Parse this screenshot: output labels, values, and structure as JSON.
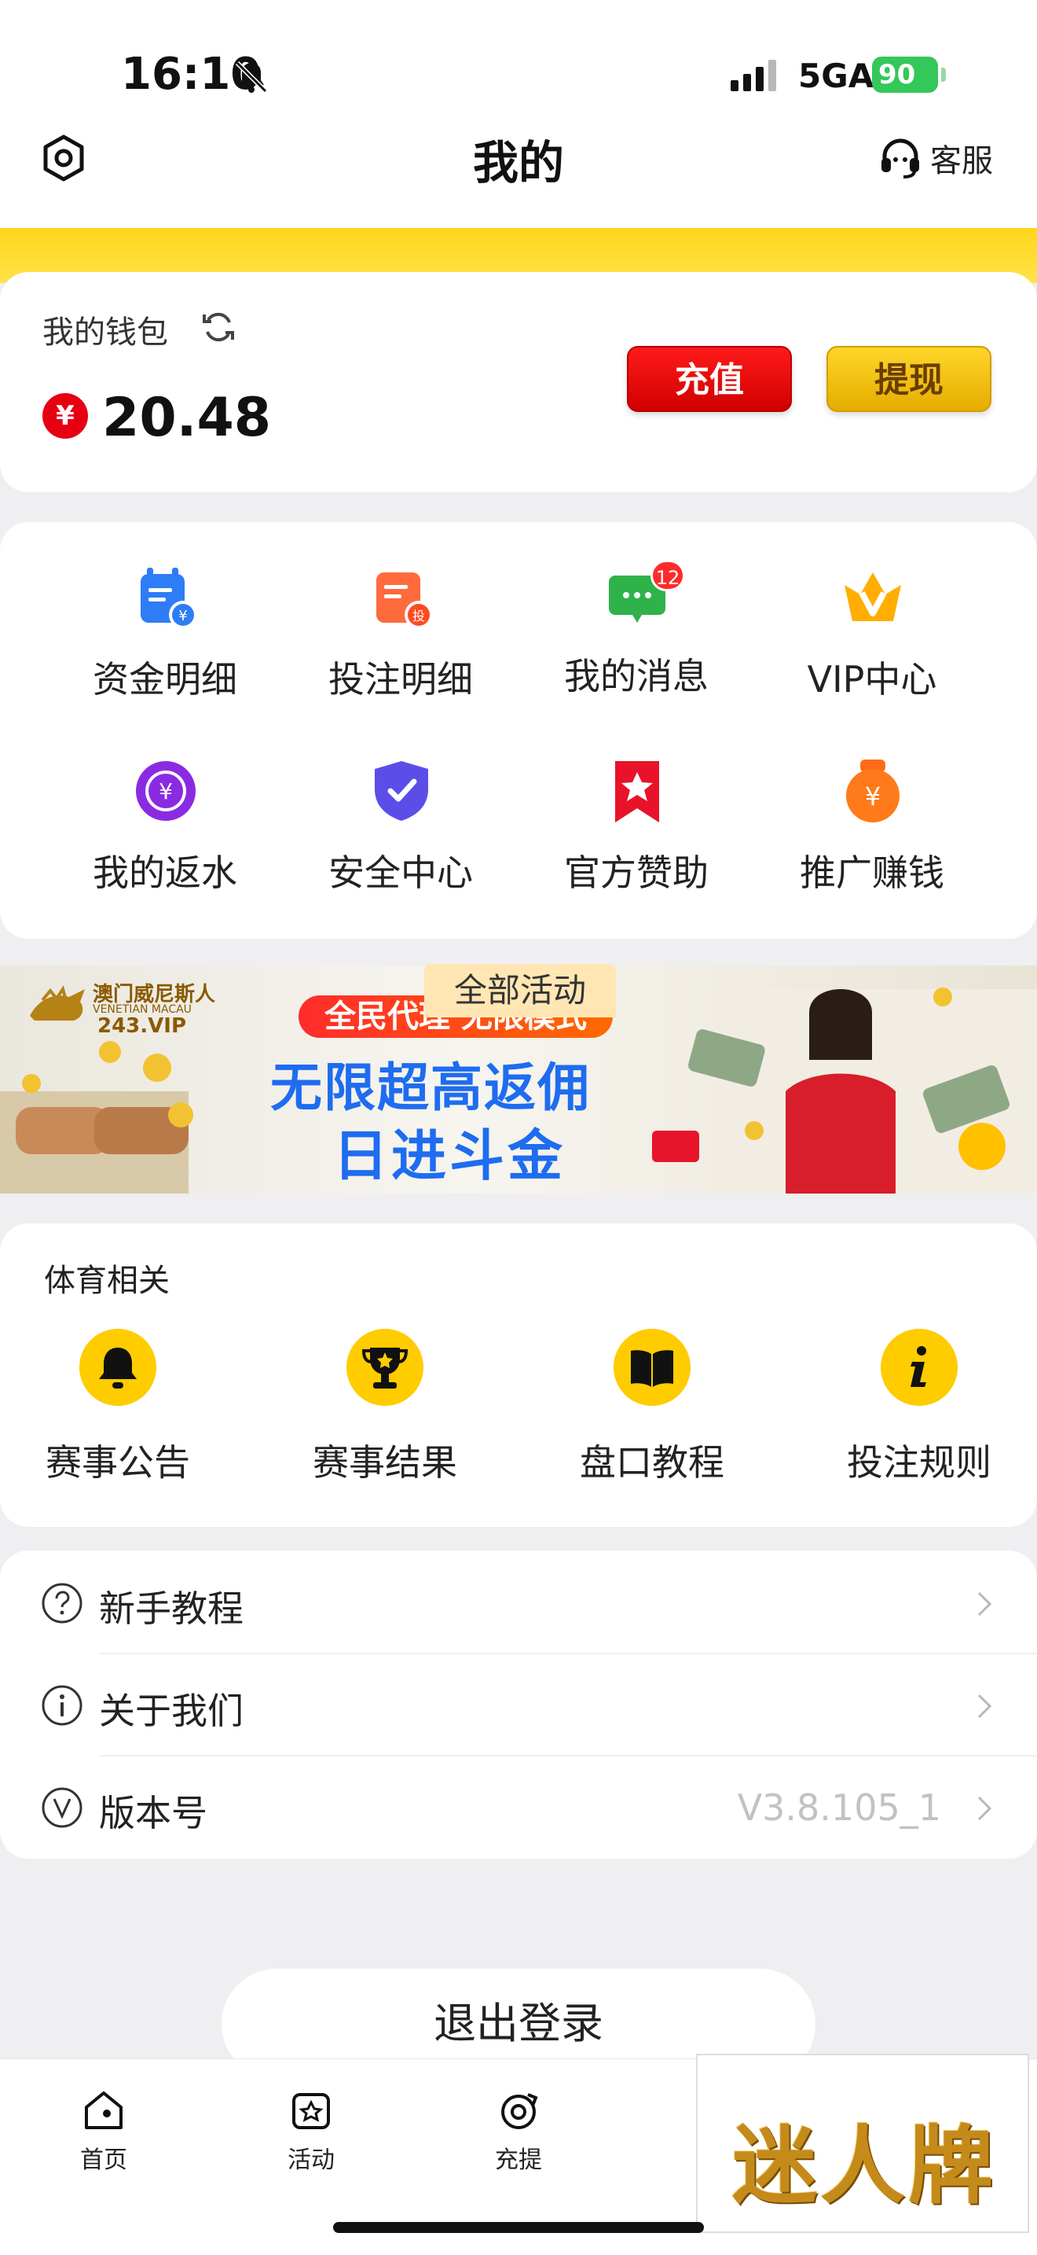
{
  "status_bar": {
    "time": "16:10",
    "network": "5GA",
    "battery": "90"
  },
  "header": {
    "title": "我的",
    "customer_service": "客服"
  },
  "wallet": {
    "title": "我的钱包",
    "currency_symbol": "¥",
    "balance": "20.48",
    "recharge_label": "充值",
    "withdraw_label": "提现"
  },
  "menu": {
    "items": [
      {
        "label": "资金明细",
        "icon": "fund-details-icon"
      },
      {
        "label": "投注明细",
        "icon": "bet-details-icon"
      },
      {
        "label": "我的消息",
        "icon": "message-icon",
        "badge": "12"
      },
      {
        "label": "VIP中心",
        "icon": "vip-icon"
      },
      {
        "label": "我的返水",
        "icon": "rebate-icon"
      },
      {
        "label": "安全中心",
        "icon": "shield-icon"
      },
      {
        "label": "官方赞助",
        "icon": "sponsor-icon"
      },
      {
        "label": "推广赚钱",
        "icon": "promote-icon"
      }
    ]
  },
  "banner": {
    "tab": "全部活动",
    "pill": "全民代理 无限模式",
    "line1": "无限超高返佣",
    "line2": "日进斗金",
    "logo_cn": "澳门威尼斯人",
    "logo_en": "VENETIAN MACAU",
    "logo_site": "243.VIP"
  },
  "sports": {
    "title": "体育相关",
    "items": [
      {
        "label": "赛事公告",
        "icon": "bell-icon"
      },
      {
        "label": "赛事结果",
        "icon": "trophy-icon"
      },
      {
        "label": "盘口教程",
        "icon": "book-icon"
      },
      {
        "label": "投注规则",
        "icon": "info-icon"
      }
    ]
  },
  "list": {
    "items": [
      {
        "label": "新手教程",
        "icon": "question-icon",
        "value": ""
      },
      {
        "label": "关于我们",
        "icon": "info-circle-icon",
        "value": ""
      },
      {
        "label": "版本号",
        "icon": "version-icon",
        "value": "V3.8.105_1"
      }
    ]
  },
  "logout_label": "退出登录",
  "tabbar": {
    "items": [
      {
        "label": "首页",
        "icon": "home-icon"
      },
      {
        "label": "活动",
        "icon": "activity-icon"
      },
      {
        "label": "充提",
        "icon": "deposit-withdraw-icon"
      }
    ]
  },
  "ad": {
    "text": "迷人牌"
  },
  "colors": {
    "accent_yellow": "#ffd51a",
    "recharge_red": "#e60012",
    "banner_blue": "#1e6cf0"
  }
}
